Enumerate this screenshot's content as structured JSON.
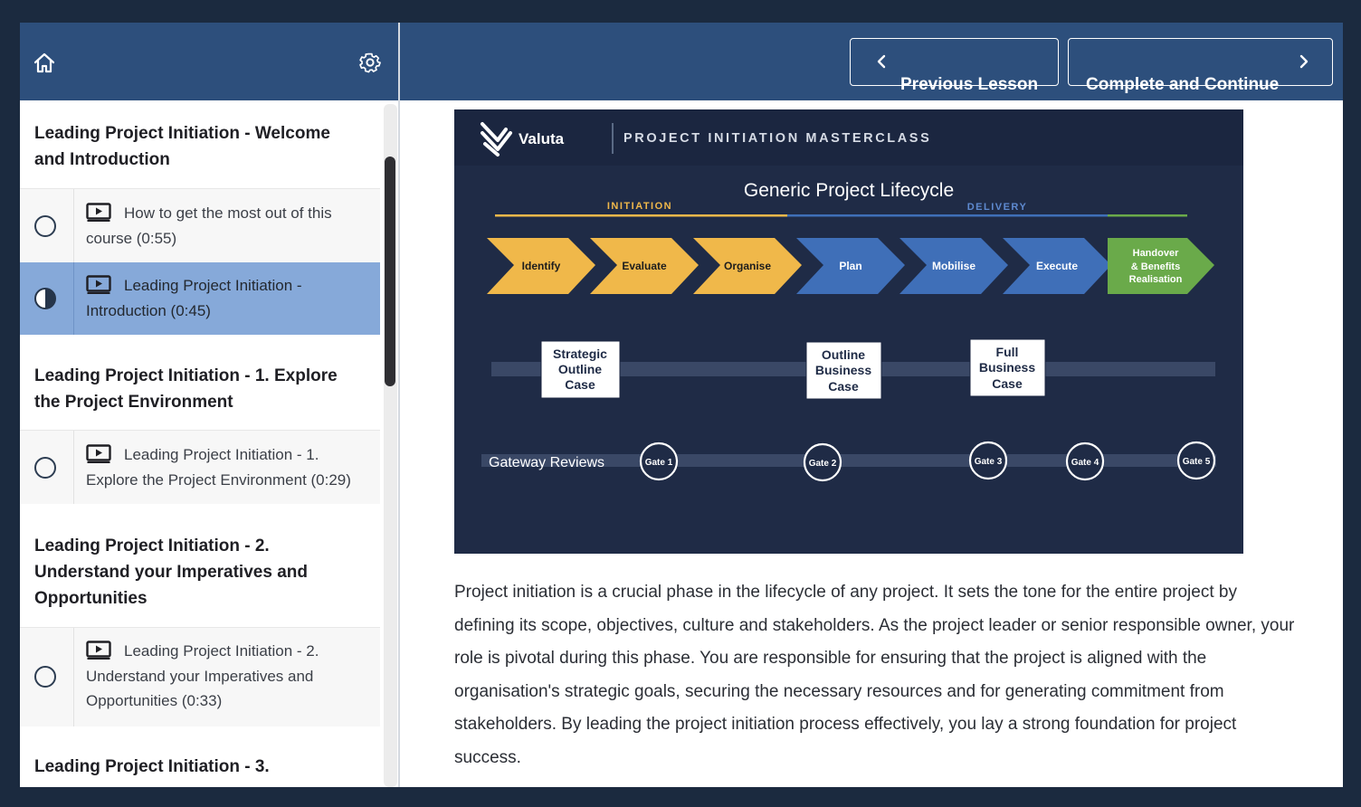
{
  "sidebar": {
    "sections": [
      {
        "title": "Leading Project Initiation - Welcome and Introduction",
        "lessons": [
          {
            "label": "How to get the most out of this course (0:55)",
            "status": "not-started"
          },
          {
            "label": "Leading Project Initiation - Introduction (0:45)",
            "status": "in-progress"
          }
        ]
      },
      {
        "title": "Leading Project Initiation - 1. Explore the Project Environment",
        "lessons": [
          {
            "label": "Leading Project Initiation - 1. Explore the Project Environment (0:29)",
            "status": "not-started"
          }
        ]
      },
      {
        "title": "Leading Project Initiation - 2. Understand your Imperatives and Opportunities",
        "lessons": [
          {
            "label": "Leading Project Initiation - 2. Understand your Imperatives and Opportunities (0:33)",
            "status": "not-started"
          }
        ]
      },
      {
        "title": "Leading Project Initiation - 3.",
        "lessons": []
      }
    ]
  },
  "topbar": {
    "prev_label": "Previous Lesson",
    "next_label": "Complete and Continue"
  },
  "slide": {
    "brand": "Valuta",
    "masterclass": "PROJECT INITIATION MASTERCLASS",
    "title": "Generic Project Lifecycle",
    "phase_initiation": "INITIATION",
    "phase_delivery": "DELIVERY",
    "stages": [
      "Identify",
      "Evaluate",
      "Organise",
      "Plan",
      "Mobilise",
      "Execute"
    ],
    "final_stage": [
      "Handover",
      "& Benefits",
      "Realisation"
    ],
    "cases": [
      [
        "Strategic",
        "Outline",
        "Case"
      ],
      [
        "Outline",
        "Business",
        "Case"
      ],
      [
        "Full",
        "Business",
        "Case"
      ]
    ],
    "gateway_label": "Gateway Reviews",
    "gates": [
      "Gate 1",
      "Gate 2",
      "Gate 3",
      "Gate 4",
      "Gate 5"
    ]
  },
  "content": {
    "paragraph": "Project initiation is a crucial phase in the lifecycle of any project. It sets the tone for the entire project by defining its scope, objectives, culture and stakeholders. As the project leader or senior responsible owner, your role is pivotal during this phase. You are responsible for ensuring that the project is aligned with the organisation's strategic goals, securing the necessary resources and for generating commitment from stakeholders. By leading the project initiation process effectively, you lay a strong foundation for project success."
  },
  "colors": {
    "header": "#2d4f7c",
    "active_lesson": "#86a9d9",
    "slide_bg": "#1f2b46",
    "initiation": "#f0b84a",
    "delivery": "#3f6fb8",
    "handover": "#6aaa4a"
  }
}
